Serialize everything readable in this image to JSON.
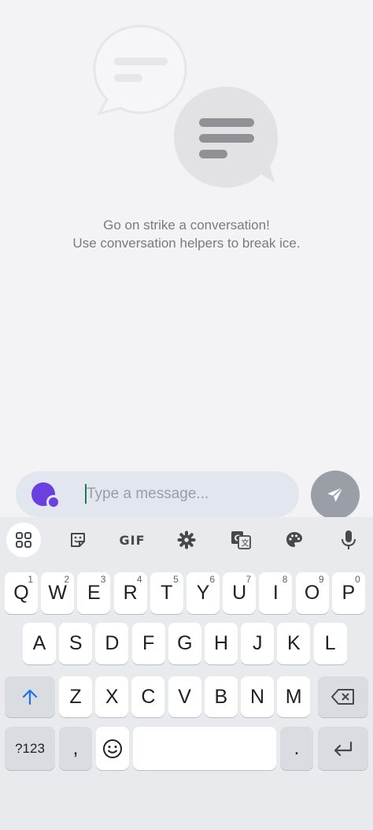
{
  "empty_state": {
    "line1": "Go on strike a conversation!",
    "line2": "Use conversation helpers to break ice."
  },
  "composer": {
    "placeholder": "Type a message...",
    "helper_icon": "conversation-helper-icon",
    "send_icon": "send-icon"
  },
  "colors": {
    "accent": "#6b3fe0",
    "send_button": "#9a9ea6",
    "composer_bg": "#e2e6ee",
    "keyboard_bg": "#e8eaed"
  },
  "keyboard": {
    "toolbar": {
      "apps_icon": "apps-grid-icon",
      "sticker_icon": "sticker-icon",
      "gif_label": "GIF",
      "settings_icon": "gear-icon",
      "translate_icon": "translate-icon",
      "theme_icon": "palette-icon",
      "mic_icon": "microphone-icon"
    },
    "row1": [
      {
        "k": "Q",
        "h": "1"
      },
      {
        "k": "W",
        "h": "2"
      },
      {
        "k": "E",
        "h": "3"
      },
      {
        "k": "R",
        "h": "4"
      },
      {
        "k": "T",
        "h": "5"
      },
      {
        "k": "Y",
        "h": "6"
      },
      {
        "k": "U",
        "h": "7"
      },
      {
        "k": "I",
        "h": "8"
      },
      {
        "k": "O",
        "h": "9"
      },
      {
        "k": "P",
        "h": "0"
      }
    ],
    "row2": [
      "A",
      "S",
      "D",
      "F",
      "G",
      "H",
      "J",
      "K",
      "L"
    ],
    "row3": [
      "Z",
      "X",
      "C",
      "V",
      "B",
      "N",
      "M"
    ],
    "bottom": {
      "symbols": "?123",
      "comma": ",",
      "period": "."
    }
  }
}
